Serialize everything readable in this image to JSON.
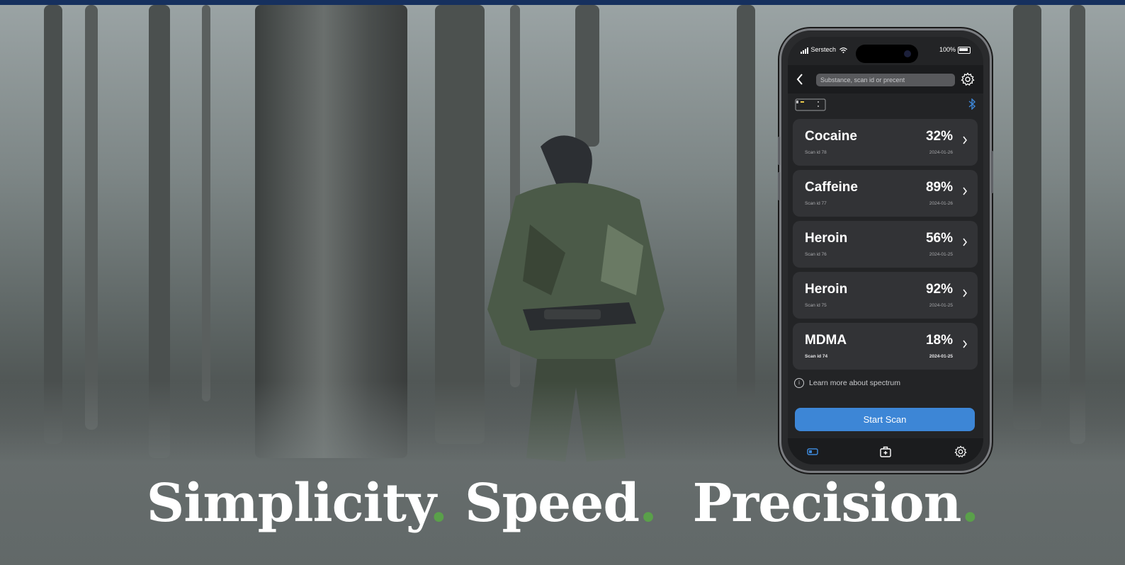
{
  "hero": {
    "headline": {
      "word1": "Simplicity",
      "word2": "Speed",
      "word3": "Precision",
      "dot": "."
    },
    "accent_color": "#5aa04a",
    "topbar_color": "#16305e"
  },
  "phone": {
    "status": {
      "carrier": "Serstech",
      "battery": "100%"
    },
    "search": {
      "placeholder": "Substance, scan id or precent"
    },
    "scans": [
      {
        "name": "Cocaine",
        "percent": "32%",
        "scan_id": "Scan id 78",
        "date": "2024-01-26"
      },
      {
        "name": "Caffeine",
        "percent": "89%",
        "scan_id": "Scan id 77",
        "date": "2024-01-26"
      },
      {
        "name": "Heroin",
        "percent": "56%",
        "scan_id": "Scan id 76",
        "date": "2024-01-25"
      },
      {
        "name": "Heroin",
        "percent": "92%",
        "scan_id": "Scan id 75",
        "date": "2024-01-25"
      },
      {
        "name": "MDMA",
        "percent": "18%",
        "scan_id": "Scan id 74",
        "date": "2024-01-25"
      }
    ],
    "learn_more": "Learn more about spectrum",
    "start_scan": "Start Scan",
    "accent_color": "#3d86d6",
    "icons": [
      "back-icon",
      "gear-icon",
      "device-icon",
      "bluetooth-icon",
      "chevron-right-icon",
      "info-icon",
      "scanner-tab-icon",
      "medkit-tab-icon",
      "settings-tab-icon"
    ]
  }
}
